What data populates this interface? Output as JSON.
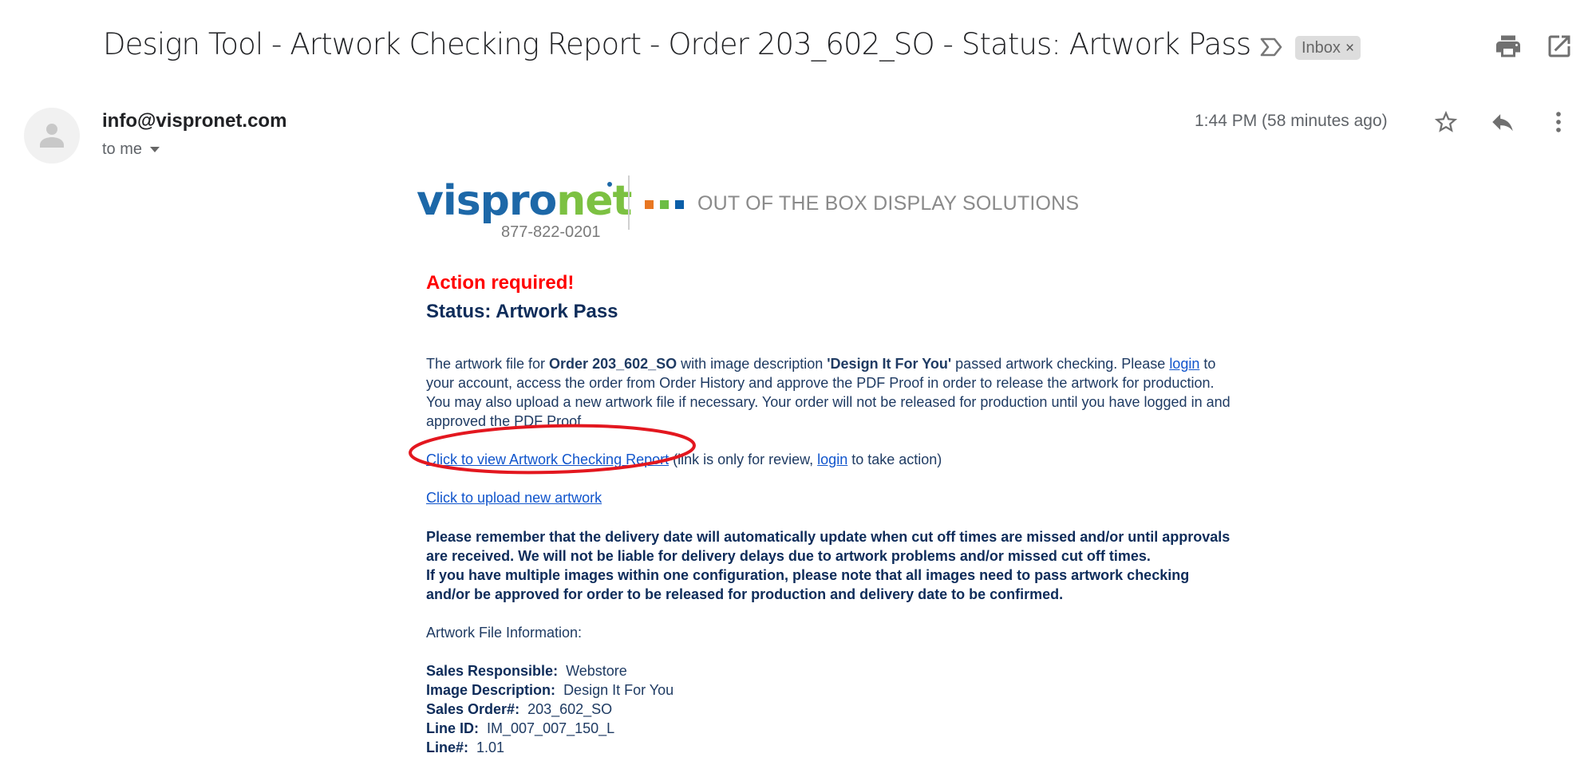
{
  "header": {
    "subject": "Design Tool - Artwork Checking Report - Order 203_602_SO - Status: Artwork Pass",
    "label_chip": "Inbox",
    "label_chip_close": "×",
    "icons": [
      "importance-marker-icon",
      "print-icon",
      "open-in-new-window-icon"
    ]
  },
  "message": {
    "sender": "info@vispronet.com",
    "recipient_label": "to me",
    "timestamp": "1:44 PM (58 minutes ago)",
    "icons": [
      "avatar-icon",
      "star-icon",
      "reply-icon",
      "more-options-icon"
    ]
  },
  "email_body": {
    "logo": {
      "word_blue": "vispro",
      "word_green": "net",
      "phone": "877-822-0201",
      "tagline": "OUT OF THE BOX DISPLAY SOLUTIONS",
      "square_colors": [
        "#e87722",
        "#6cbd45",
        "#0b5ea8"
      ]
    },
    "action_required": "Action required!",
    "status": "Status: Artwork Pass",
    "intro": {
      "t1": "The artwork file for ",
      "order_bold": "Order 203_602_SO",
      "t2": " with image description ",
      "desc_bold": "'Design It For You'",
      "t3": " passed artwork checking. Please ",
      "login_link": "login",
      "t4": " to your account, access the order from Order History and approve the PDF Proof in order to release the artwork for production. You may also upload a new artwork file if necessary. Your order will not be released for production until you have logged in and approved the PDF Proof."
    },
    "report_link": "Click to view Artwork Checking Report",
    "report_note_1": " (link is only for review, ",
    "report_note_login": "login",
    "report_note_2": " to take action)",
    "upload_link": "Click to upload new artwork",
    "notice_1": "Please remember that the delivery date will automatically update when cut off times are missed and/or until approvals are received. We will not be liable for delivery delays due to artwork problems and/or missed cut off times.",
    "notice_2": "If you have multiple images within one configuration, please note that all images need to pass artwork checking and/or be approved for order to be released for production and delivery date to be confirmed.",
    "file_info_heading": "Artwork File Information:",
    "file_info": [
      {
        "key": "Sales Responsible:",
        "value": "Webstore"
      },
      {
        "key": "Image Description:",
        "value": "Design It For You"
      },
      {
        "key": "Sales Order#:",
        "value": "203_602_SO"
      },
      {
        "key": "Line ID:",
        "value": "IM_007_007_150_L"
      },
      {
        "key": "Line#:",
        "value": "1.01"
      }
    ]
  },
  "annotation": {
    "highlight_color": "#e3171f",
    "highlight_target": "Click to view Artwork Checking Report"
  },
  "colors": {
    "link": "#1155cc",
    "alert_red": "#ff0000",
    "body_navy": "#17365d"
  }
}
